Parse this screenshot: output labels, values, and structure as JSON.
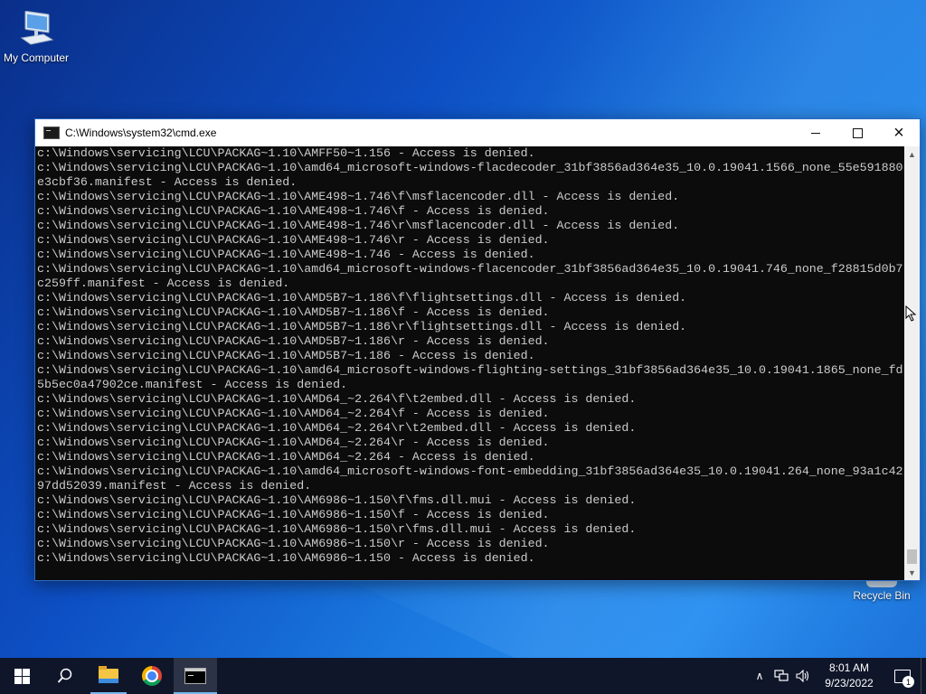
{
  "desktop": {
    "icons": [
      {
        "label": "My Computer",
        "icon": "my-computer-icon"
      },
      {
        "label": "Recycle Bin",
        "icon": "recycle-bin-icon"
      }
    ]
  },
  "window": {
    "title": "C:\\Windows\\system32\\cmd.exe",
    "controls": {
      "minimize": "minimize-icon",
      "maximize": "maximize-icon",
      "close": "×"
    },
    "console_lines": [
      "c:\\Windows\\servicing\\LCU\\PACKAG~1.10\\AMFF50~1.156 - Access is denied.",
      "c:\\Windows\\servicing\\LCU\\PACKAG~1.10\\amd64_microsoft-windows-flacdecoder_31bf3856ad364e35_10.0.19041.1566_none_55e591880",
      "e3cbf36.manifest - Access is denied.",
      "c:\\Windows\\servicing\\LCU\\PACKAG~1.10\\AME498~1.746\\f\\msflacencoder.dll - Access is denied.",
      "c:\\Windows\\servicing\\LCU\\PACKAG~1.10\\AME498~1.746\\f - Access is denied.",
      "c:\\Windows\\servicing\\LCU\\PACKAG~1.10\\AME498~1.746\\r\\msflacencoder.dll - Access is denied.",
      "c:\\Windows\\servicing\\LCU\\PACKAG~1.10\\AME498~1.746\\r - Access is denied.",
      "c:\\Windows\\servicing\\LCU\\PACKAG~1.10\\AME498~1.746 - Access is denied.",
      "c:\\Windows\\servicing\\LCU\\PACKAG~1.10\\amd64_microsoft-windows-flacencoder_31bf3856ad364e35_10.0.19041.746_none_f28815d0b7",
      "c259ff.manifest - Access is denied.",
      "c:\\Windows\\servicing\\LCU\\PACKAG~1.10\\AMD5B7~1.186\\f\\flightsettings.dll - Access is denied.",
      "c:\\Windows\\servicing\\LCU\\PACKAG~1.10\\AMD5B7~1.186\\f - Access is denied.",
      "c:\\Windows\\servicing\\LCU\\PACKAG~1.10\\AMD5B7~1.186\\r\\flightsettings.dll - Access is denied.",
      "c:\\Windows\\servicing\\LCU\\PACKAG~1.10\\AMD5B7~1.186\\r - Access is denied.",
      "c:\\Windows\\servicing\\LCU\\PACKAG~1.10\\AMD5B7~1.186 - Access is denied.",
      "c:\\Windows\\servicing\\LCU\\PACKAG~1.10\\amd64_microsoft-windows-flighting-settings_31bf3856ad364e35_10.0.19041.1865_none_fd",
      "5b5ec0a47902ce.manifest - Access is denied.",
      "c:\\Windows\\servicing\\LCU\\PACKAG~1.10\\AMD64_~2.264\\f\\t2embed.dll - Access is denied.",
      "c:\\Windows\\servicing\\LCU\\PACKAG~1.10\\AMD64_~2.264\\f - Access is denied.",
      "c:\\Windows\\servicing\\LCU\\PACKAG~1.10\\AMD64_~2.264\\r\\t2embed.dll - Access is denied.",
      "c:\\Windows\\servicing\\LCU\\PACKAG~1.10\\AMD64_~2.264\\r - Access is denied.",
      "c:\\Windows\\servicing\\LCU\\PACKAG~1.10\\AMD64_~2.264 - Access is denied.",
      "c:\\Windows\\servicing\\LCU\\PACKAG~1.10\\amd64_microsoft-windows-font-embedding_31bf3856ad364e35_10.0.19041.264_none_93a1c42",
      "97dd52039.manifest - Access is denied.",
      "c:\\Windows\\servicing\\LCU\\PACKAG~1.10\\AM6986~1.150\\f\\fms.dll.mui - Access is denied.",
      "c:\\Windows\\servicing\\LCU\\PACKAG~1.10\\AM6986~1.150\\f - Access is denied.",
      "c:\\Windows\\servicing\\LCU\\PACKAG~1.10\\AM6986~1.150\\r\\fms.dll.mui - Access is denied.",
      "c:\\Windows\\servicing\\LCU\\PACKAG~1.10\\AM6986~1.150\\r - Access is denied.",
      "c:\\Windows\\servicing\\LCU\\PACKAG~1.10\\AM6986~1.150 - Access is denied."
    ],
    "scrollbar": {
      "up": "▲",
      "down": "▼",
      "position": 1.0
    }
  },
  "taskbar": {
    "apps": [
      {
        "name": "start",
        "icon": "windows-logo-icon"
      },
      {
        "name": "search",
        "icon": "search-icon"
      },
      {
        "name": "file-explorer",
        "icon": "folder-icon",
        "running": true
      },
      {
        "name": "chrome",
        "icon": "chrome-icon",
        "running": false
      },
      {
        "name": "cmd",
        "icon": "cmd-icon",
        "running": true,
        "active": true
      }
    ],
    "tray": {
      "chevron": "∧",
      "clock_time": "8:01 AM",
      "clock_date": "9/23/2022",
      "notification_count": "1"
    }
  },
  "colors": {
    "console_bg": "#0c0c0c",
    "console_text": "#cccccc",
    "taskbar_bg": "#10162a",
    "accent": "#76b9ed"
  }
}
